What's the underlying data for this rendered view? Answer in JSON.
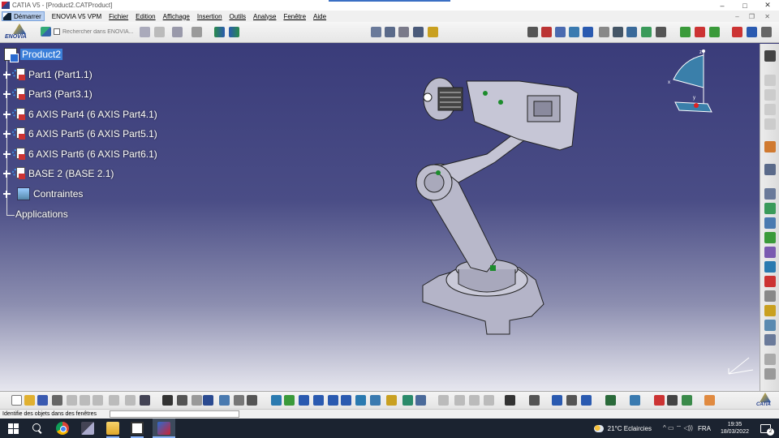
{
  "window": {
    "title": "CATIA V5 - [Product2.CATProduct]",
    "controls": {
      "minimize": "–",
      "maximize": "□",
      "close": "✕"
    }
  },
  "menu": {
    "start": "Démarrer",
    "items": [
      "ENOVIA V5 VPM",
      "Fichier",
      "Edition",
      "Affichage",
      "Insertion",
      "Outils",
      "Analyse",
      "Fenêtre",
      "Aide"
    ],
    "right_controls": "– ❐ ✕"
  },
  "toolbar": {
    "enovia_label": "ENOVIA",
    "search_placeholder": "Rechercher dans ENOVIA..."
  },
  "tree": {
    "root": "Product2",
    "nodes": [
      "Part1 (Part1.1)",
      "Part3 (Part3.1)",
      "6 AXIS Part4 (6 AXIS Part4.1)",
      "6 AXIS Part5 (6 AXIS Part5.1)",
      "6 AXIS Part6 (6 AXIS Part6.1)",
      "BASE 2 (BASE 2.1)"
    ],
    "constraints": "Contraintes",
    "applications": "Applications"
  },
  "compass": {
    "x": "x",
    "y": "y",
    "z": "z"
  },
  "bottom_toolbar": {
    "catia_label": "CATIA"
  },
  "status": {
    "text": "Identifie des objets dans des fenêtres"
  },
  "taskbar": {
    "weather": "21°C  Eclaircies",
    "language": "FRA",
    "time": "19:35",
    "date": "18/03/2022",
    "notifications": "2",
    "tray_symbols": "^  ▭  ⌔  ◁))"
  },
  "colors": {
    "background_top": "#3a3c7a",
    "background_bottom": "#e7e7ef",
    "selection": "#3b7fd9",
    "tree_text": "#ffffff"
  }
}
